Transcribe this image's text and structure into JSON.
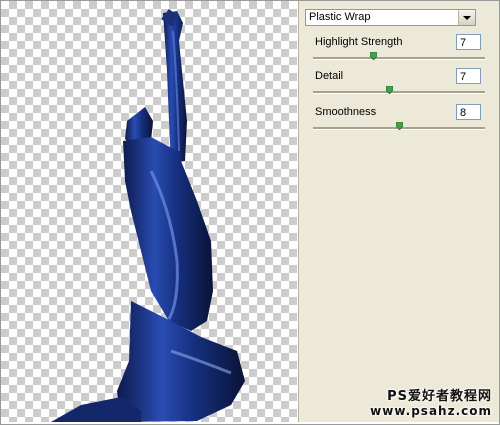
{
  "filter": {
    "selected": "Plastic Wrap"
  },
  "params": [
    {
      "label": "Highlight Strength",
      "value": "7",
      "level": 0.35
    },
    {
      "label": "Detail",
      "value": "7",
      "level": 0.44
    },
    {
      "label": "Smoothness",
      "value": "8",
      "level": 0.5
    }
  ],
  "watermark": {
    "line1": "PS爱好者教程网",
    "line2": "www.psahz.com"
  },
  "colors": {
    "figure_blue": "#1e3a8a",
    "panel_bg": "#ece9d8",
    "thumb_green": "#3fa14a"
  }
}
